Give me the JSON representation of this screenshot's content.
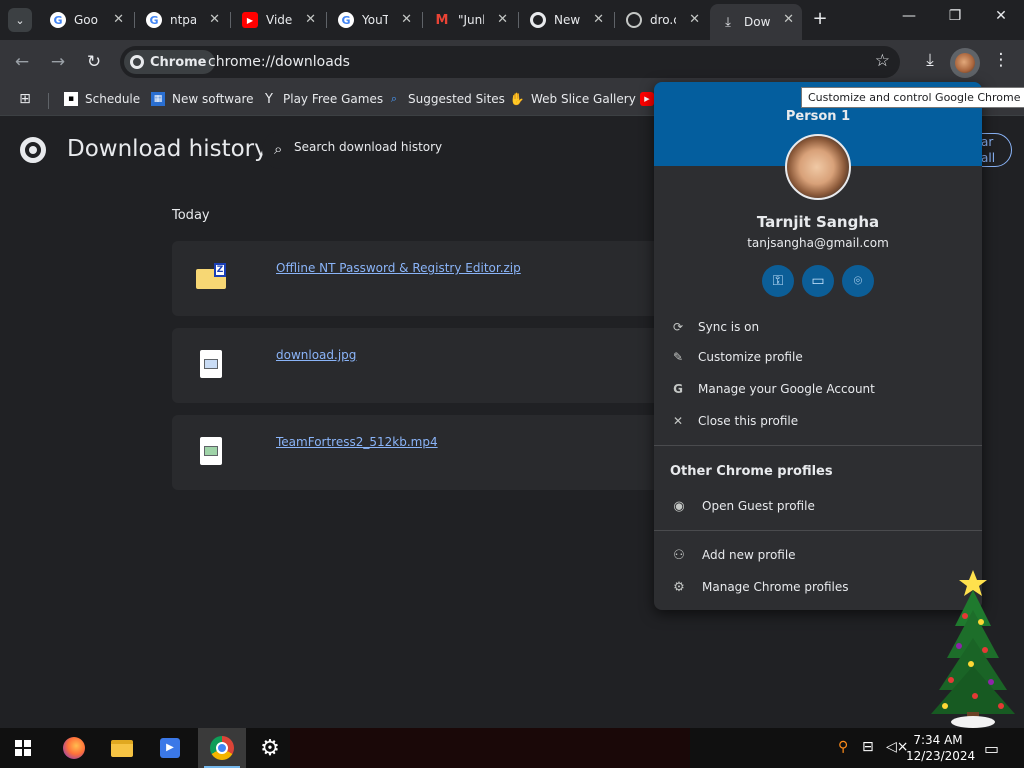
{
  "tabs": [
    {
      "title": "Goo",
      "favicon": "google-icon"
    },
    {
      "title": "ntpa",
      "favicon": "google-icon"
    },
    {
      "title": "Vide",
      "favicon": "youtube-icon"
    },
    {
      "title": "YouT",
      "favicon": "google-icon"
    },
    {
      "title": "\"Junk",
      "favicon": "gmail-icon"
    },
    {
      "title": "New",
      "favicon": "chrome-icon"
    },
    {
      "title": "dro.c",
      "favicon": "globe-icon"
    },
    {
      "title": "Dow",
      "favicon": "download-icon"
    }
  ],
  "toolbar": {
    "chip_label": "Chrome",
    "url": "chrome://downloads"
  },
  "bookmarks": [
    {
      "label": "Schedule",
      "icon": "schedule-icon"
    },
    {
      "label": "New software",
      "icon": "software-icon"
    },
    {
      "label": "Play Free Games",
      "icon": "games-icon"
    },
    {
      "label": "Suggested Sites",
      "icon": "suggested-sites-icon"
    },
    {
      "label": "Web Slice Gallery",
      "icon": "web-slice-icon"
    }
  ],
  "downloads_page": {
    "title": "Download history",
    "search_placeholder": "Search download history",
    "clear_all": "ar all",
    "group_label": "Today",
    "items": [
      {
        "filename": "Offline NT Password & Registry Editor.zip",
        "icon": "zip-folder-icon"
      },
      {
        "filename": "download.jpg",
        "icon": "image-file-icon"
      },
      {
        "filename": "TeamFortress2_512kb.mp4",
        "icon": "video-file-icon"
      }
    ]
  },
  "tooltip": "Customize and control Google Chrome",
  "profile_menu": {
    "header_label": "Person 1",
    "name": "Tarnjit Sangha",
    "email": "tanjsangha@gmail.com",
    "quick_actions": [
      "password-key-icon",
      "payment-card-icon",
      "address-pin-icon"
    ],
    "items": [
      "Sync is on",
      "Customize profile",
      "Manage your Google Account",
      "Close this profile"
    ],
    "other_profiles_heading": "Other Chrome profiles",
    "guest_label": "Open Guest profile",
    "add_label": "Add new profile",
    "manage_label": "Manage Chrome profiles",
    "header_color": "#045e9e"
  },
  "taskbar": {
    "time": "7:34 AM",
    "date": "12/23/2024"
  }
}
